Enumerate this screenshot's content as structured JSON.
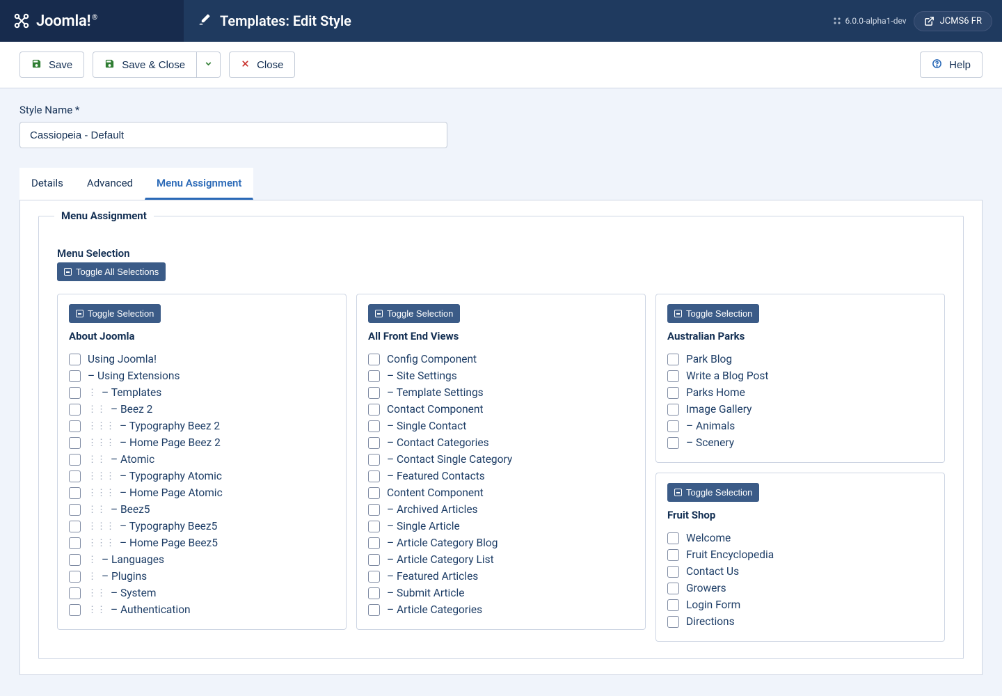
{
  "header": {
    "brand": "Joomla!",
    "reg": "®",
    "page_title": "Templates: Edit Style",
    "version": "6.0.0-alpha1-dev",
    "site_name": "JCMS6 FR"
  },
  "toolbar": {
    "save": "Save",
    "save_close": "Save & Close",
    "close": "Close",
    "help": "Help"
  },
  "form": {
    "style_name_label": "Style Name *",
    "style_name_value": "Cassiopeia - Default"
  },
  "tabs": {
    "details": "Details",
    "advanced": "Advanced",
    "menu_assignment": "Menu Assignment"
  },
  "assignment": {
    "legend": "Menu Assignment",
    "menu_selection_label": "Menu Selection",
    "toggle_all": "Toggle All Selections",
    "toggle_selection": "Toggle Selection"
  },
  "cards": [
    {
      "title": "About Joomla",
      "items": [
        {
          "indent": 0,
          "label": "Using Joomla!"
        },
        {
          "indent": 0,
          "label": "– Using Extensions"
        },
        {
          "indent": 1,
          "label": "– Templates"
        },
        {
          "indent": 2,
          "label": "– Beez 2"
        },
        {
          "indent": 3,
          "label": "– Typography Beez 2"
        },
        {
          "indent": 3,
          "label": "– Home Page Beez 2"
        },
        {
          "indent": 2,
          "label": "– Atomic"
        },
        {
          "indent": 3,
          "label": "– Typography Atomic"
        },
        {
          "indent": 3,
          "label": "– Home Page Atomic"
        },
        {
          "indent": 2,
          "label": "– Beez5"
        },
        {
          "indent": 3,
          "label": "– Typography Beez5"
        },
        {
          "indent": 3,
          "label": "– Home Page Beez5"
        },
        {
          "indent": 1,
          "label": "– Languages"
        },
        {
          "indent": 1,
          "label": "– Plugins"
        },
        {
          "indent": 2,
          "label": "– System"
        },
        {
          "indent": 2,
          "label": "– Authentication"
        }
      ]
    },
    {
      "title": "All Front End Views",
      "items": [
        {
          "indent": 0,
          "label": "Config Component"
        },
        {
          "indent": 0,
          "label": "– Site Settings"
        },
        {
          "indent": 0,
          "label": "– Template Settings"
        },
        {
          "indent": 0,
          "label": "Contact Component"
        },
        {
          "indent": 0,
          "label": "– Single Contact"
        },
        {
          "indent": 0,
          "label": "– Contact Categories"
        },
        {
          "indent": 0,
          "label": "– Contact Single Category"
        },
        {
          "indent": 0,
          "label": "– Featured Contacts"
        },
        {
          "indent": 0,
          "label": "Content Component"
        },
        {
          "indent": 0,
          "label": "– Archived Articles"
        },
        {
          "indent": 0,
          "label": "– Single Article"
        },
        {
          "indent": 0,
          "label": "– Article Category Blog"
        },
        {
          "indent": 0,
          "label": "– Article Category List"
        },
        {
          "indent": 0,
          "label": "– Featured Articles"
        },
        {
          "indent": 0,
          "label": "– Submit Article"
        },
        {
          "indent": 0,
          "label": "– Article Categories"
        }
      ]
    },
    {
      "title": "Australian Parks",
      "items": [
        {
          "indent": 0,
          "label": "Park Blog"
        },
        {
          "indent": 0,
          "label": "Write a Blog Post"
        },
        {
          "indent": 0,
          "label": "Parks Home"
        },
        {
          "indent": 0,
          "label": "Image Gallery"
        },
        {
          "indent": 0,
          "label": "– Animals"
        },
        {
          "indent": 0,
          "label": "– Scenery"
        }
      ]
    },
    {
      "title": "Fruit Shop",
      "items": [
        {
          "indent": 0,
          "label": "Welcome"
        },
        {
          "indent": 0,
          "label": "Fruit Encyclopedia"
        },
        {
          "indent": 0,
          "label": "Contact Us"
        },
        {
          "indent": 0,
          "label": "Growers"
        },
        {
          "indent": 0,
          "label": "Login Form"
        },
        {
          "indent": 0,
          "label": "Directions"
        }
      ]
    }
  ]
}
